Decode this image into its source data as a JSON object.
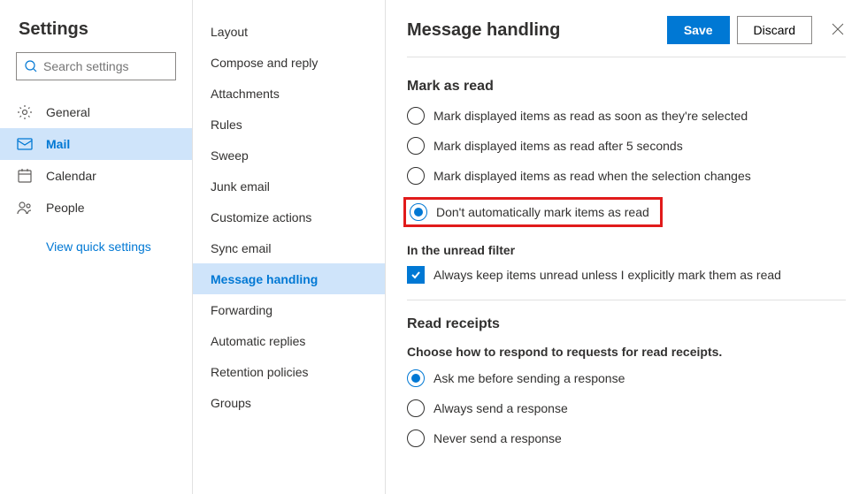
{
  "title": "Settings",
  "search": {
    "placeholder": "Search settings"
  },
  "nav": [
    {
      "label": "General"
    },
    {
      "label": "Mail"
    },
    {
      "label": "Calendar"
    },
    {
      "label": "People"
    }
  ],
  "quick_link": "View quick settings",
  "subnav": [
    "Layout",
    "Compose and reply",
    "Attachments",
    "Rules",
    "Sweep",
    "Junk email",
    "Customize actions",
    "Sync email",
    "Message handling",
    "Forwarding",
    "Automatic replies",
    "Retention policies",
    "Groups"
  ],
  "content": {
    "title": "Message handling",
    "save": "Save",
    "discard": "Discard",
    "mark_as_read": {
      "heading": "Mark as read",
      "options": [
        "Mark displayed items as read as soon as they're selected",
        "Mark displayed items as read after 5 seconds",
        "Mark displayed items as read when the selection changes",
        "Don't automatically mark items as read"
      ],
      "selected_index": 3,
      "unread_filter_heading": "In the unread filter",
      "unread_filter_option": "Always keep items unread unless I explicitly mark them as read",
      "unread_filter_checked": true
    },
    "read_receipts": {
      "heading": "Read receipts",
      "desc": "Choose how to respond to requests for read receipts.",
      "options": [
        "Ask me before sending a response",
        "Always send a response",
        "Never send a response"
      ],
      "selected_index": 0
    }
  }
}
